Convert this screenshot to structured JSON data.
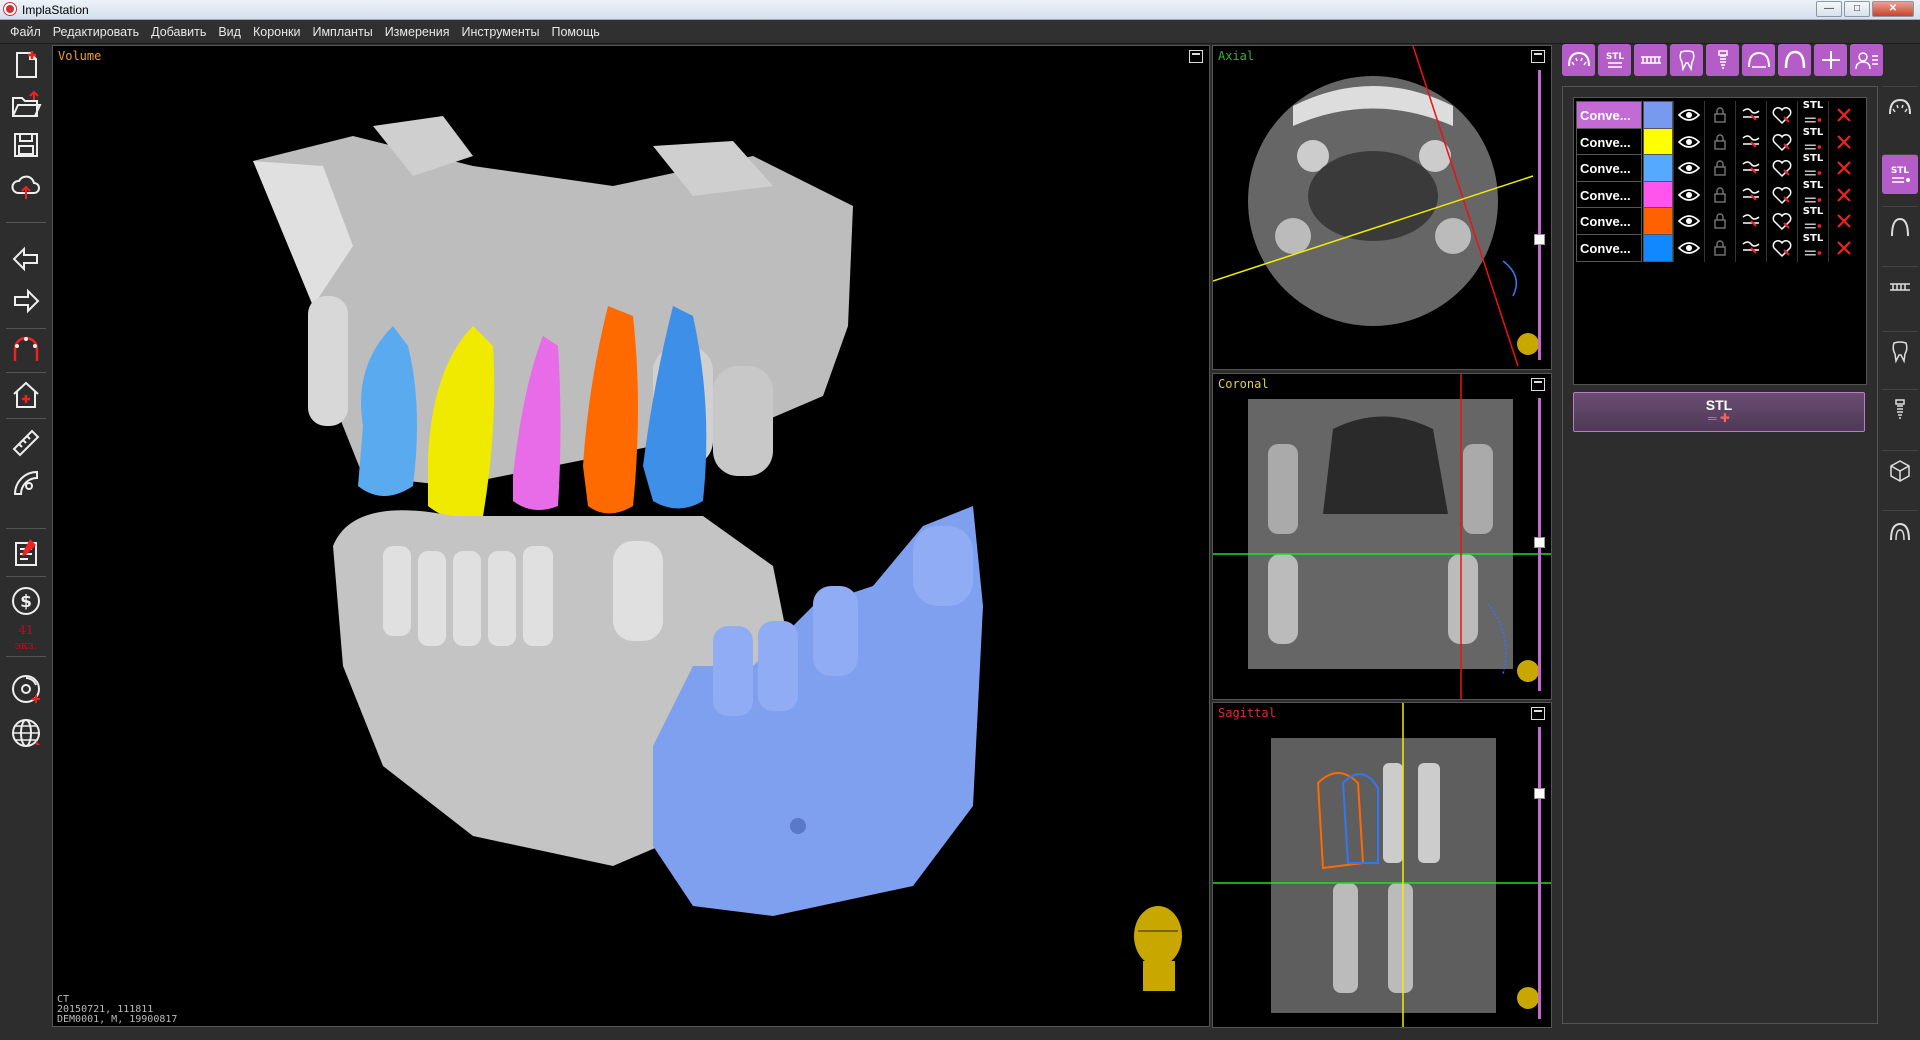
{
  "window": {
    "title": "ImplaStation",
    "minimize": "—",
    "maximize": "□",
    "close": "✕"
  },
  "menu": [
    "Файл",
    "Редактировать",
    "Добавить",
    "Вид",
    "Коронки",
    "Импланты",
    "Измерения",
    "Инструменты",
    "Помощь"
  ],
  "left_toolbar": {
    "icons": [
      "new-document-icon",
      "open-folder-icon",
      "save-icon",
      "cloud-upload-icon",
      "undo-arrow-icon",
      "redo-arrow-icon",
      "dental-arch-icon",
      "home-icon",
      "ruler-icon",
      "protractor-icon",
      "report-icon",
      "dollar-icon",
      "disc-icon",
      "globe-icon"
    ],
    "counter_value": "41",
    "counter_unit": "экз."
  },
  "viewports": {
    "volume": {
      "label": "Volume",
      "label_color": "#f0a020",
      "info": [
        "CT",
        "20150721, 111811",
        "DEM0001, M, 19900817"
      ]
    },
    "axial": {
      "label": "Axial",
      "label_color": "#2fb52f"
    },
    "coronal": {
      "label": "Coronal",
      "label_color": "#e0d040"
    },
    "sagittal": {
      "label": "Sagittal",
      "label_color": "#e03030"
    }
  },
  "top_tools": [
    "teeth-arch-icon",
    "stl-list-icon",
    "teeth-row-icon",
    "tooth-icon",
    "implant-icon",
    "panorama-icon",
    "arch-curve-icon",
    "plus-icon",
    "user-card-icon"
  ],
  "objects": [
    {
      "name": "Conve...",
      "color": "#7799ee",
      "selected": true
    },
    {
      "name": "Conve...",
      "color": "#ffff00",
      "selected": false
    },
    {
      "name": "Conve...",
      "color": "#55aaff",
      "selected": false
    },
    {
      "name": "Conve...",
      "color": "#ff55ee",
      "selected": false
    },
    {
      "name": "Conve...",
      "color": "#ff6000",
      "selected": false
    },
    {
      "name": "Conve...",
      "color": "#1188ff",
      "selected": false
    }
  ],
  "object_icon_labels": {
    "stl": "STL"
  },
  "stl_button": {
    "label": "STL",
    "mark": "═ ✚"
  },
  "right_tabs": [
    "teeth-arch-icon",
    "stl-list-icon",
    "arch-curve-icon",
    "teeth-row-icon",
    "tooth-icon",
    "implant-icon",
    "cube-3d-icon",
    "jaw-icon"
  ],
  "colors": {
    "accent": "#b45cc7",
    "axis_green": "#22dd22",
    "axis_red": "#ee1111",
    "axis_yellow": "#eeee00"
  }
}
